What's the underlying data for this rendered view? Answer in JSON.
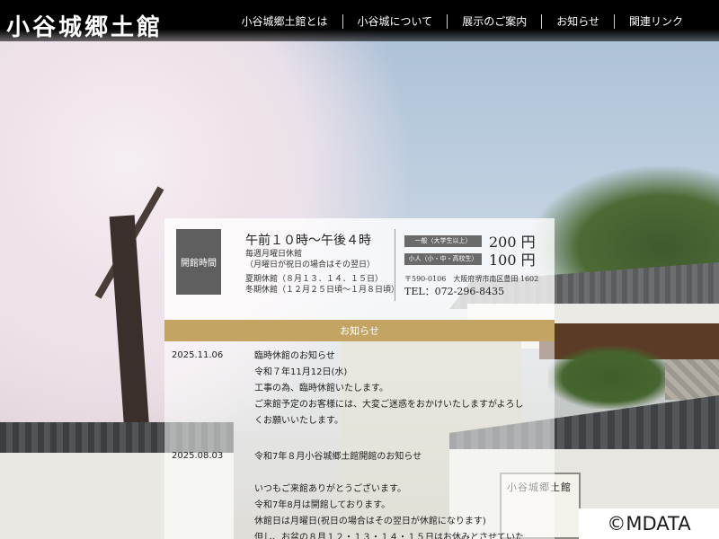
{
  "header": {
    "logo": "小谷城郷土館",
    "nav": [
      {
        "label": "小谷城郷土館とは"
      },
      {
        "label": "小谷城について"
      },
      {
        "label": "展示のご案内"
      },
      {
        "label": "お知らせ"
      },
      {
        "label": "関連リンク"
      }
    ]
  },
  "background": {
    "sign_text": "小谷城郷土館"
  },
  "hours": {
    "label": "開館時間",
    "main": "午前１０時～午後４時",
    "closed_weekly": "毎週月曜日休館",
    "closed_note": "（月曜日が祝日の場合はその翌日）",
    "summer": "夏期休館（８月１３．１４．１５日）",
    "winter": "冬期休館（１２月２５日頃～１月８日頃）"
  },
  "prices": [
    {
      "label": "一般（大学生以上）",
      "value": "200 円"
    },
    {
      "label": "小人（小・中・高校生）",
      "value": "100 円"
    }
  ],
  "address": "〒590-0106　大阪府堺市南区豊田 1602",
  "tel": "TEL：072-296-8435",
  "news": {
    "title": "お知らせ",
    "items": [
      {
        "date": "2025.11.06",
        "lines": [
          "臨時休館のお知らせ",
          "令和７年11月12日(水)",
          "工事の為、臨時休館いたします。",
          "ご来館予定のお客様には、大変ご迷惑をおかけいたしますがよろし",
          "くお願いいたします。"
        ]
      },
      {
        "date": "2025.08.03",
        "lines": [
          "令和7年８月小谷城郷土館開館のお知らせ",
          "",
          "いつもご来館ありがとうございます。",
          "令和7年8月は開館しております。",
          "休館日は月曜日(祝日の場合はその翌日が休館になります)",
          "但し、お盆の８月１２・１３・１４・１５日はお休みとさせていた"
        ]
      }
    ]
  },
  "copyright": "©MDATA"
}
